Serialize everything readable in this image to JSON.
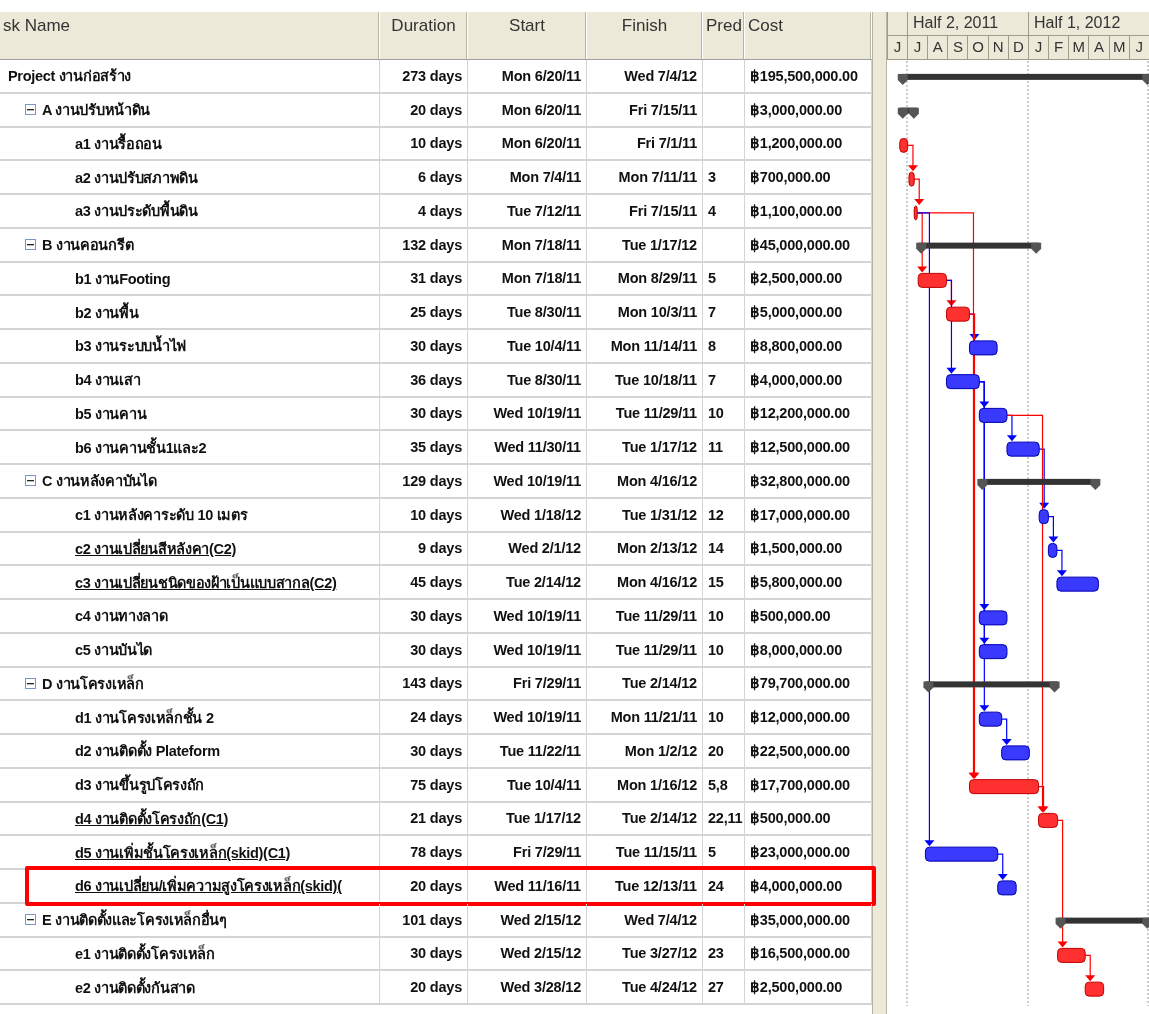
{
  "table": {
    "columns": [
      "sk Name",
      "Duration",
      "Start",
      "Finish",
      "Pred",
      "Cost"
    ]
  },
  "timescale": {
    "halves": [
      "Half 2, 2011",
      "Half 1, 2012"
    ],
    "months": [
      "J",
      "J",
      "A",
      "S",
      "O",
      "N",
      "D",
      "J",
      "F",
      "M",
      "A",
      "M",
      "J"
    ]
  },
  "tasks": [
    {
      "kind": "project",
      "name": "Project งานก่อสร้าง",
      "duration": "273 days",
      "start": "Mon 6/20/11",
      "finish": "Wed 7/4/12",
      "cost": "฿195,500,000.00",
      "children": [
        {
          "kind": "summary",
          "expanded": true,
          "name": "A  งานปรับหน้าดิน",
          "duration": "20 days",
          "start": "Mon 6/20/11",
          "finish": "Fri 7/15/11",
          "cost": "฿3,000,000.00",
          "children": [
            {
              "kind": "task",
              "name": "a1 งานรื้อถอน",
              "duration": "10 days",
              "start": "Mon 6/20/11",
              "finish": "Fri 7/1/11",
              "cost": "฿1,200,000.00",
              "critical": true,
              "underlined": false,
              "highlighted": false
            },
            {
              "kind": "task",
              "name": "a2 งานปรับสภาพดิน",
              "duration": "6 days",
              "start": "Mon 7/4/11",
              "finish": "Mon 7/11/11",
              "pred": "3",
              "cost": "฿700,000.00",
              "critical": true,
              "underlined": false,
              "highlighted": false
            },
            {
              "kind": "task",
              "name": "a3 งานประดับพื้นดิน",
              "duration": "4 days",
              "start": "Tue 7/12/11",
              "finish": "Fri 7/15/11",
              "pred": "4",
              "cost": "฿1,100,000.00",
              "critical": true,
              "underlined": false,
              "highlighted": false
            }
          ]
        },
        {
          "kind": "summary",
          "expanded": true,
          "name": "B งานคอนกรีต",
          "duration": "132 days",
          "start": "Mon 7/18/11",
          "finish": "Tue 1/17/12",
          "cost": "฿45,000,000.00",
          "children": [
            {
              "kind": "task",
              "name": "b1 งานFooting",
              "duration": "31 days",
              "start": "Mon 7/18/11",
              "finish": "Mon 8/29/11",
              "pred": "5",
              "cost": "฿2,500,000.00",
              "critical": true,
              "underlined": false,
              "highlighted": false
            },
            {
              "kind": "task",
              "name": "b2 งานพื้น",
              "duration": "25 days",
              "start": "Tue 8/30/11",
              "finish": "Mon 10/3/11",
              "pred": "7",
              "cost": "฿5,000,000.00",
              "critical": true,
              "underlined": false,
              "highlighted": false
            },
            {
              "kind": "task",
              "name": "b3 งานระบบน้ำไฟ",
              "duration": "30 days",
              "start": "Tue 10/4/11",
              "finish": "Mon 11/14/11",
              "pred": "8",
              "cost": "฿8,800,000.00",
              "critical": false,
              "underlined": false,
              "highlighted": false
            },
            {
              "kind": "task",
              "name": "b4 งานเสา",
              "duration": "36 days",
              "start": "Tue 8/30/11",
              "finish": "Tue 10/18/11",
              "pred": "7",
              "cost": "฿4,000,000.00",
              "critical": false,
              "underlined": false,
              "highlighted": false
            },
            {
              "kind": "task",
              "name": "b5 งานคาน",
              "duration": "30 days",
              "start": "Wed 10/19/11",
              "finish": "Tue 11/29/11",
              "pred": "10",
              "cost": "฿12,200,000.00",
              "critical": false,
              "underlined": false,
              "highlighted": false
            },
            {
              "kind": "task",
              "name": "b6 งานคานชั้น1และ2",
              "duration": "35 days",
              "start": "Wed 11/30/11",
              "finish": "Tue 1/17/12",
              "pred": "11",
              "cost": "฿12,500,000.00",
              "critical": false,
              "underlined": false,
              "highlighted": false
            }
          ]
        },
        {
          "kind": "summary",
          "expanded": true,
          "name": "C งานหลังคาบันได",
          "duration": "129 days",
          "start": "Wed 10/19/11",
          "finish": "Mon 4/16/12",
          "cost": "฿32,800,000.00",
          "children": [
            {
              "kind": "task",
              "name": "c1 งานหลังคาระดับ 10 เมตร",
              "duration": "10 days",
              "start": "Wed 1/18/12",
              "finish": "Tue 1/31/12",
              "pred": "12",
              "cost": "฿17,000,000.00",
              "critical": false,
              "underlined": false,
              "highlighted": false
            },
            {
              "kind": "task",
              "name": "c2 งานเปลี่ยนสีหลังคา(C2)",
              "duration": "9 days",
              "start": "Wed 2/1/12",
              "finish": "Mon 2/13/12",
              "pred": "14",
              "cost": "฿1,500,000.00",
              "critical": false,
              "underlined": true,
              "highlighted": false
            },
            {
              "kind": "task",
              "name": "c3 งานเปลี่ยนชนิดของฝ้าเป็นแบบสากล(C2)",
              "duration": "45 days",
              "start": "Tue 2/14/12",
              "finish": "Mon 4/16/12",
              "pred": "15",
              "cost": "฿5,800,000.00",
              "critical": false,
              "underlined": true,
              "highlighted": false
            },
            {
              "kind": "task",
              "name": "c4 งานทางลาด",
              "duration": "30 days",
              "start": "Wed 10/19/11",
              "finish": "Tue 11/29/11",
              "pred": "10",
              "cost": "฿500,000.00",
              "critical": false,
              "underlined": false,
              "highlighted": false
            },
            {
              "kind": "task",
              "name": "c5 งานบันได",
              "duration": "30 days",
              "start": "Wed 10/19/11",
              "finish": "Tue 11/29/11",
              "pred": "10",
              "cost": "฿8,000,000.00",
              "critical": false,
              "underlined": false,
              "highlighted": false
            }
          ]
        },
        {
          "kind": "summary",
          "expanded": true,
          "name": "D งานโครงเหล็ก",
          "duration": "143 days",
          "start": "Fri 7/29/11",
          "finish": "Tue 2/14/12",
          "cost": "฿79,700,000.00",
          "children": [
            {
              "kind": "task",
              "name": "d1 งานโครงเหล็กชั้น 2",
              "duration": "24 days",
              "start": "Wed 10/19/11",
              "finish": "Mon 11/21/11",
              "pred": "10",
              "cost": "฿12,000,000.00",
              "critical": false,
              "underlined": false,
              "highlighted": false
            },
            {
              "kind": "task",
              "name": "d2 งานติดตั้ง Plateform",
              "duration": "30 days",
              "start": "Tue 11/22/11",
              "finish": "Mon 1/2/12",
              "pred": "20",
              "cost": "฿22,500,000.00",
              "critical": false,
              "underlined": false,
              "highlighted": false
            },
            {
              "kind": "task",
              "name": "d3 งานขึ้นรูปโครงถัก",
              "duration": "75 days",
              "start": "Tue 10/4/11",
              "finish": "Mon 1/16/12",
              "pred": "5,8",
              "cost": "฿17,700,000.00",
              "critical": true,
              "underlined": false,
              "highlighted": false
            },
            {
              "kind": "task",
              "name": "d4 งานติดตั้งโครงถัก(C1)",
              "duration": "21 days",
              "start": "Tue 1/17/12",
              "finish": "Tue 2/14/12",
              "pred": "22,11",
              "cost": "฿500,000.00",
              "critical": true,
              "underlined": true,
              "highlighted": false
            },
            {
              "kind": "task",
              "name": "d5 งานเพิ่มชั้นโครงเหล็ก(skid)(C1)",
              "duration": "78 days",
              "start": "Fri 7/29/11",
              "finish": "Tue 11/15/11",
              "pred": "5",
              "cost": "฿23,000,000.00",
              "critical": false,
              "underlined": true,
              "highlighted": false
            },
            {
              "kind": "task",
              "name": "d6 งานเปลี่ยน/เพิ่มความสูงโครงเหล็ก(skid)(",
              "duration": "20 days",
              "start": "Wed 11/16/11",
              "finish": "Tue 12/13/11",
              "pred": "24",
              "cost": "฿4,000,000.00",
              "critical": false,
              "underlined": true,
              "highlighted": true
            }
          ]
        },
        {
          "kind": "summary",
          "expanded": true,
          "name": "E งานติดตั้งและโครงเหล็กอื่นๆ",
          "duration": "101 days",
          "start": "Wed 2/15/12",
          "finish": "Wed 7/4/12",
          "cost": "฿35,000,000.00",
          "children": [
            {
              "kind": "task",
              "name": "e1 งานติดตั้งโครงเหล็ก",
              "duration": "30 days",
              "start": "Wed 2/15/12",
              "finish": "Tue 3/27/12",
              "pred": "23",
              "cost": "฿16,500,000.00",
              "critical": true,
              "underlined": false,
              "highlighted": false
            },
            {
              "kind": "task",
              "name": "e2 งานติดตั้งกันสาด",
              "duration": "20 days",
              "start": "Wed 3/28/12",
              "finish": "Tue 4/24/12",
              "pred": "27",
              "cost": "฿2,500,000.00",
              "critical": true,
              "underlined": false,
              "highlighted": false
            }
          ]
        }
      ]
    }
  ]
}
